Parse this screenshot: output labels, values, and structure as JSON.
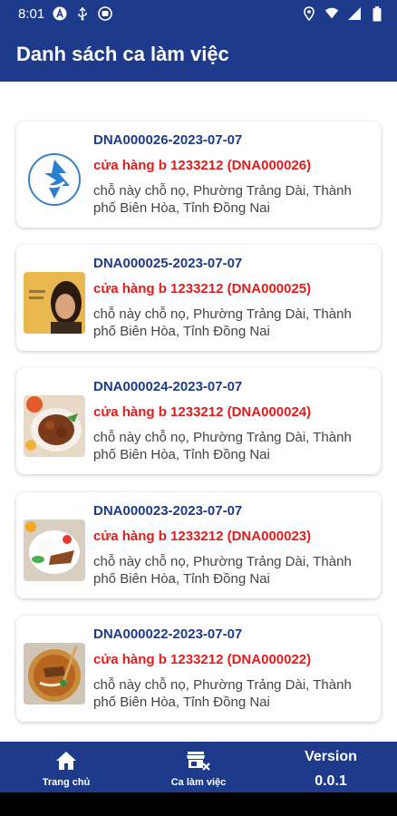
{
  "status_bar": {
    "time": "8:01"
  },
  "app_bar": {
    "title": "Danh sách ca làm việc"
  },
  "shifts": [
    {
      "code": "DNA000026-2023-07-07",
      "store": "cửa hàng b 1233212 (DNA000026)",
      "address": "chỗ này chỗ nọ, Phường Trảng Dài, Thành phố Biên Hòa, Tỉnh Đồng Nai",
      "thumbnail": "logo-image"
    },
    {
      "code": "DNA000025-2023-07-07",
      "store": "cửa hàng b 1233212 (DNA000025)",
      "address": "chỗ này chỗ nọ, Phường Trảng Dài, Thành phố Biên Hòa, Tỉnh Đồng Nai",
      "thumbnail": "person-photo"
    },
    {
      "code": "DNA000024-2023-07-07",
      "store": "cửa hàng b 1233212 (DNA000024)",
      "address": "chỗ này chỗ nọ, Phường Trảng Dài, Thành phố Biên Hòa, Tỉnh Đồng Nai",
      "thumbnail": "food-photo"
    },
    {
      "code": "DNA000023-2023-07-07",
      "store": "cửa hàng b 1233212 (DNA000023)",
      "address": "chỗ này chỗ nọ, Phường Trảng Dài, Thành phố Biên Hòa, Tỉnh Đồng Nai",
      "thumbnail": "food-photo"
    },
    {
      "code": "DNA000022-2023-07-07",
      "store": "cửa hàng b 1233212 (DNA000022)",
      "address": "chỗ này chỗ nọ, Phường Trảng Dài, Thành phố Biên Hòa, Tỉnh Đồng Nai",
      "thumbnail": "food-photo"
    }
  ],
  "bottom_nav": {
    "home_label": "Trang chủ",
    "shifts_label": "Ca làm việc",
    "version_label": "Version",
    "version_value": "0.0.1"
  },
  "colors": {
    "primary": "#1e3a8a",
    "store_text": "#e11d1d",
    "address_text": "#444444"
  }
}
